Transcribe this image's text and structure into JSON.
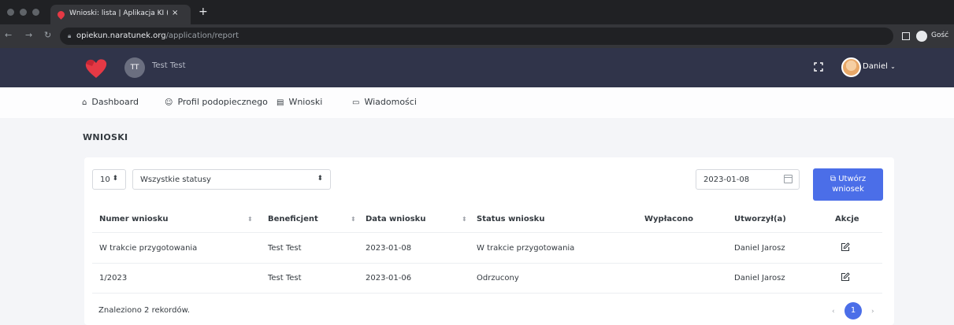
{
  "browser": {
    "tab_title": "Wnioski: lista | Aplikacja KI (Ko",
    "tab_close": "×",
    "new_tab": "+",
    "url_domain": "opiekun.naratunek.org",
    "url_path": "/application/report",
    "profile_label": "Gość"
  },
  "header": {
    "org_initials": "TT",
    "org_name": "Test Test",
    "user_name": "Daniel"
  },
  "nav": {
    "items": [
      {
        "label": "Dashboard",
        "icon": "home-icon"
      },
      {
        "label": "Profil podopiecznego",
        "icon": "profile-icon"
      },
      {
        "label": "Wnioski",
        "icon": "document-icon"
      },
      {
        "label": "Wiadomości",
        "icon": "message-icon"
      }
    ]
  },
  "page": {
    "title": "WNIOSKI"
  },
  "filters": {
    "page_size": "10",
    "status_filter": "Wszystkie statusy",
    "date": "2023-01-08",
    "create_button_line1": "Utwórz",
    "create_button_line2": "wniosek"
  },
  "table": {
    "columns": [
      "Numer wniosku",
      "Beneficjent",
      "Data wniosku",
      "Status wniosku",
      "Wypłacono",
      "Utworzył(a)",
      "Akcje"
    ],
    "rows": [
      {
        "number": "W trakcie przygotowania",
        "beneficiary": "Test Test",
        "date": "2023-01-08",
        "status": "W trakcie przygotowania",
        "paid": "",
        "created_by": "Daniel Jarosz"
      },
      {
        "number": "1/2023",
        "beneficiary": "Test Test",
        "date": "2023-01-06",
        "status": "Odrzucony",
        "paid": "",
        "created_by": "Daniel Jarosz"
      }
    ]
  },
  "footer": {
    "records_text": "Znaleziono 2 rekordów.",
    "current_page": "1"
  },
  "colors": {
    "header_bg": "#30344a",
    "accent": "#4b6ee8",
    "logo": "#e53945"
  }
}
